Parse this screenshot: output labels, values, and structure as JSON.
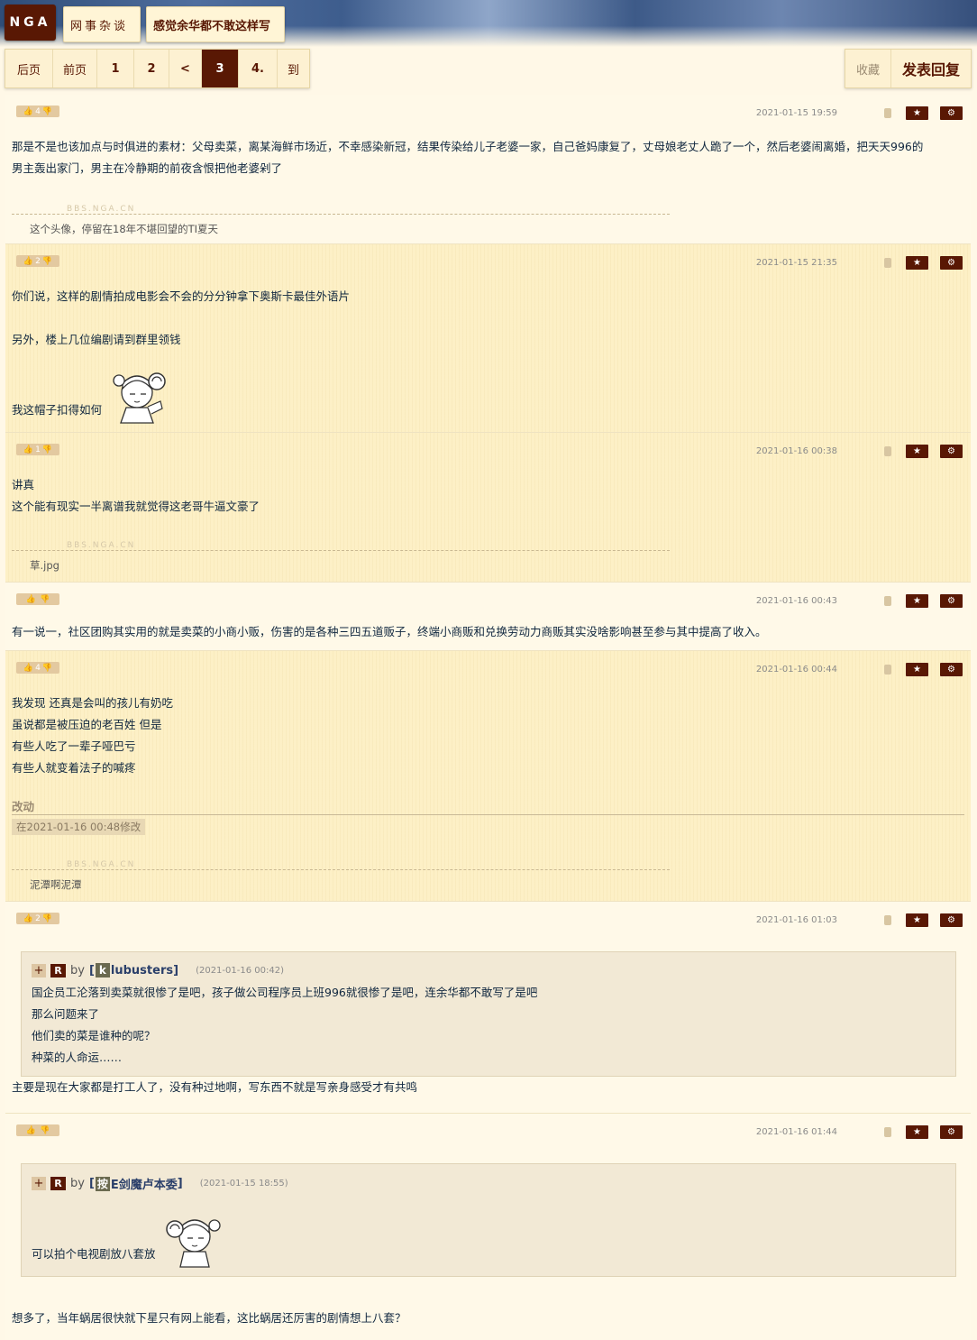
{
  "header": {
    "logo": "NGA",
    "board": "网事杂谈",
    "thread_title": "感觉余华都不敢这样写"
  },
  "pager": {
    "items": [
      "后页",
      "前页",
      "1",
      "2",
      "<",
      "3",
      "4.",
      "到"
    ],
    "current": "3"
  },
  "actions": {
    "favorite": "收藏",
    "reply": "发表回复"
  },
  "colors": {
    "accent": "#591804",
    "background": "#fff8e7",
    "alt_row": "#fdf0c6"
  },
  "posts": [
    {
      "votes": "4",
      "time": "2021-01-15 19:59",
      "device": "android-icon",
      "lines": [
        "那是不是也该加点与时俱进的素材：父母卖菜，离某海鲜市场近，不幸感染新冠，结果传染给儿子老婆一家，自己爸妈康复了，丈母娘老丈人跪了一个，然后老婆闹离婚，把天天996的",
        "男主轰出家门，男主在冷静期的前夜含恨把他老婆剁了"
      ],
      "sig_watermark": "BBS.NGA.CN",
      "signature": "这个头像，停留在18年不堪回望的TI夏天"
    },
    {
      "votes": "2",
      "time": "2021-01-15 21:35",
      "device": "android-icon",
      "lines": [
        "你们说，这样的剧情拍成电影会不会的分分钟拿下奥斯卡最佳外语片",
        "",
        "另外，楼上几位编剧请到群里领钱",
        "",
        "",
        "我这帽子扣得如何"
      ]
    },
    {
      "votes": "1",
      "time": "2021-01-16 00:38",
      "device": "apple-icon",
      "lines": [
        "讲真",
        "这个能有现实一半离谱我就觉得这老哥牛逼文豪了"
      ],
      "sig_watermark": "BBS.NGA.CN",
      "signature": "草.jpg"
    },
    {
      "votes": "",
      "time": "2021-01-16 00:43",
      "device": "phone-icon",
      "lines": [
        "有一说一，社区团购其实用的就是卖菜的小商小贩，伤害的是各种三四五道贩子，终端小商贩和兑换劳动力商贩其实没啥影响甚至参与其中提高了收入。"
      ]
    },
    {
      "votes": "4",
      "time": "2021-01-16 00:44",
      "device": "apple-icon",
      "lines": [
        "我发现 还真是会叫的孩儿有奶吃",
        "虽说都是被压迫的老百姓 但是",
        "有些人吃了一辈子哑巴亏",
        "有些人就变着法子的喊疼"
      ],
      "edit_title": "改动",
      "edit_note": "在2021-01-16 00:48修改",
      "sig_watermark": "BBS.NGA.CN",
      "signature": "泥潭啊泥潭"
    },
    {
      "votes": "2",
      "time": "2021-01-16 01:03",
      "device": "android-icon",
      "quote": {
        "plus": "+",
        "r": "R",
        "by": "by",
        "user_initial": "k",
        "user_rest": "lubusters",
        "time": "(2021-01-16 00:42)",
        "lines": [
          "国企员工沦落到卖菜就很惨了是吧，孩子做公司程序员上班996就很惨了是吧，连余华都不敢写了是吧",
          "那么问题来了",
          "他们卖的菜是谁种的呢？",
          "种菜的人命运……"
        ]
      },
      "lines": [
        "主要是现在大家都是打工人了，没有种过地啊，写东西不就是写亲身感受才有共鸣"
      ]
    },
    {
      "votes": "",
      "time": "2021-01-16 01:44",
      "device": "android-icon",
      "quote": {
        "plus": "+",
        "r": "R",
        "by": "by",
        "user_initial": "按",
        "user_rest": "E剑魔卢本委",
        "time": "(2021-01-15 18:55)",
        "lines": [
          "可以拍个电视剧放八套放"
        ]
      },
      "lines": [
        "想多了，当年蜗居很快就下星只有网上能看，这比蜗居还厉害的剧情想上八套？"
      ]
    }
  ]
}
